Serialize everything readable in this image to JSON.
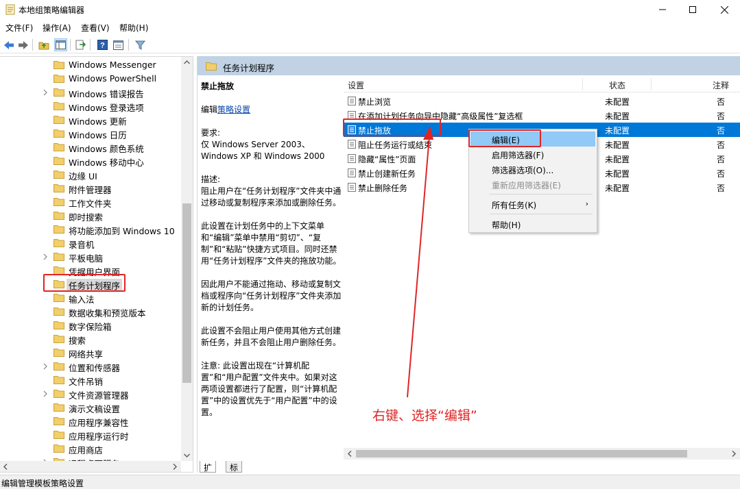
{
  "window": {
    "title": "本地组策略编辑器",
    "controls": [
      "minimize",
      "maximize",
      "close"
    ]
  },
  "menu": [
    "文件(F)",
    "操作(A)",
    "查看(V)",
    "帮助(H)"
  ],
  "toolbar_icons": [
    "back-arrow-icon",
    "forward-arrow-icon",
    "up-folder-icon",
    "show-hide-tree-icon",
    "export-list-icon",
    "help-icon",
    "properties-icon",
    "filter-icon"
  ],
  "tree": {
    "items": [
      {
        "label": "Windows Messenger",
        "expandable": false
      },
      {
        "label": "Windows PowerShell",
        "expandable": false
      },
      {
        "label": "Windows 错误报告",
        "expandable": true
      },
      {
        "label": "Windows 登录选项",
        "expandable": false
      },
      {
        "label": "Windows 更新",
        "expandable": false
      },
      {
        "label": "Windows 日历",
        "expandable": false
      },
      {
        "label": "Windows 颜色系统",
        "expandable": false
      },
      {
        "label": "Windows 移动中心",
        "expandable": false
      },
      {
        "label": "边缘 UI",
        "expandable": false
      },
      {
        "label": "附件管理器",
        "expandable": false
      },
      {
        "label": "工作文件夹",
        "expandable": false
      },
      {
        "label": "即时搜索",
        "expandable": false
      },
      {
        "label": "将功能添加到 Windows 10",
        "expandable": false
      },
      {
        "label": "录音机",
        "expandable": false
      },
      {
        "label": "平板电脑",
        "expandable": true
      },
      {
        "label": "凭据用户界面",
        "expandable": false
      },
      {
        "label": "任务计划程序",
        "expandable": false,
        "selected": true
      },
      {
        "label": "输入法",
        "expandable": false
      },
      {
        "label": "数据收集和预览版本",
        "expandable": false
      },
      {
        "label": "数字保险箱",
        "expandable": false
      },
      {
        "label": "搜索",
        "expandable": false
      },
      {
        "label": "网络共享",
        "expandable": false
      },
      {
        "label": "位置和传感器",
        "expandable": true
      },
      {
        "label": "文件吊销",
        "expandable": false
      },
      {
        "label": "文件资源管理器",
        "expandable": true
      },
      {
        "label": "演示文稿设置",
        "expandable": false
      },
      {
        "label": "应用程序兼容性",
        "expandable": false
      },
      {
        "label": "应用程序运行时",
        "expandable": false
      },
      {
        "label": "应用商店",
        "expandable": false
      },
      {
        "label": "远程桌面服务",
        "expandable": true
      }
    ]
  },
  "pane": {
    "header": "任务计划程序",
    "description": {
      "title": "禁止拖放",
      "edit_prefix": "编辑",
      "edit_link": "策略设置",
      "requirements_label": "要求:",
      "requirements_text": "仅 Windows Server 2003、Windows XP 和 Windows 2000",
      "desc_label": "描述:",
      "paragraphs": [
        "阻止用户在“任务计划程序”文件夹中通过移动或复制程序来添加或删除任务。",
        "此设置在计划任务中的上下文菜单和“编辑”菜单中禁用“剪切”、“复制”和“粘贴”快捷方式项目。同时还禁用“任务计划程序”文件夹的拖放功能。",
        "因此用户不能通过拖动、移动或复制文档或程序向“任务计划程序”文件夹添加新的计划任务。",
        "此设置不会阻止用户使用其他方式创建新任务，并且不会阻止用户删除任务。",
        "注意: 此设置出现在“计算机配置”和“用户配置”文件夹中。如果对这两项设置都进行了配置，则“计算机配置”中的设置优先于“用户配置”中的设置。"
      ]
    },
    "columns": {
      "setting": "设置",
      "state": "状态",
      "note": "注释"
    },
    "rows": [
      {
        "name": "禁止浏览",
        "state": "未配置",
        "note": "否"
      },
      {
        "name": "在添加计划任务向导中隐藏“高级属性”复选框",
        "state": "未配置",
        "note": "否"
      },
      {
        "name": "禁止拖放",
        "state": "未配置",
        "note": "否",
        "selected": true
      },
      {
        "name": "阻止任务运行或结束",
        "state": "未配置",
        "note": "否"
      },
      {
        "name": "隐藏“属性”页面",
        "state": "未配置",
        "note": "否"
      },
      {
        "name": "禁止创建新任务",
        "state": "未配置",
        "note": "否"
      },
      {
        "name": "禁止删除任务",
        "state": "未配置",
        "note": "否"
      }
    ],
    "tabs": [
      "扩展",
      "标准"
    ]
  },
  "context_menu": {
    "items": [
      {
        "label": "编辑(E)",
        "highlighted": true
      },
      {
        "label": "启用筛选器(F)"
      },
      {
        "label": "筛选器选项(O)..."
      },
      {
        "label": "重新应用筛选器(E)",
        "disabled": true
      },
      {
        "label": "所有任务(K)",
        "submenu": true
      },
      {
        "label": "帮助(H)"
      }
    ]
  },
  "annotation": {
    "text": "右键、选择“编辑”",
    "color": "#e02424"
  },
  "status": "编辑管理模板策略设置",
  "colors": {
    "selection": "#0078d7",
    "menu_highlight": "#91c9f7",
    "pane_header": "#c0d2e4",
    "annotation_red": "#e02424"
  }
}
